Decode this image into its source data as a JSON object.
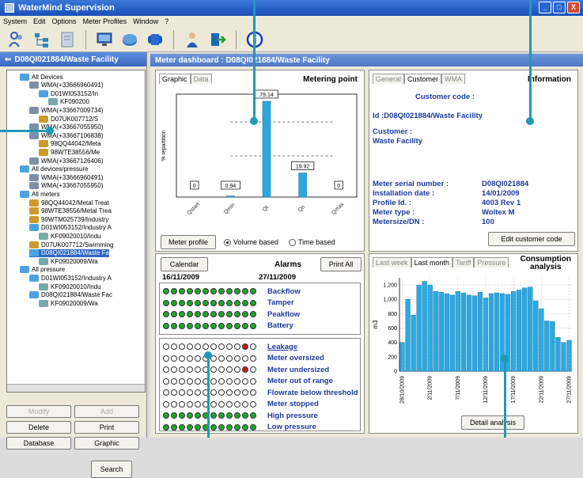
{
  "window": {
    "title": "WaterMind Supervision",
    "controls": [
      "_",
      "□",
      "X"
    ]
  },
  "menu": [
    "System",
    "Edit",
    "Options",
    "Meter Profiles",
    "Window",
    "?"
  ],
  "toolbar_icons": [
    "users-icon",
    "tree-icon",
    "document-icon",
    "monitor-icon",
    "meter-icon",
    "pipe-icon",
    "user-icon",
    "exit-icon",
    "info-icon"
  ],
  "left_panel": {
    "title": "D08QI021884/Waste Facility",
    "tree": [
      {
        "label": "All Devices",
        "indent": 1,
        "icon": "blue"
      },
      {
        "label": "WMA(+33666960491)",
        "indent": 2,
        "icon": "dev"
      },
      {
        "label": "D01WI053152/In",
        "indent": 3,
        "icon": "blue"
      },
      {
        "label": "KF090200",
        "indent": 4,
        "icon": "key"
      },
      {
        "label": "WMA(+33667009734)",
        "indent": 2,
        "icon": "dev"
      },
      {
        "label": "D07UK007712/S",
        "indent": 3,
        "icon": "meter"
      },
      {
        "label": "WMA(+33667055950)",
        "indent": 2,
        "icon": "dev"
      },
      {
        "label": "WMA(+33667106838)",
        "indent": 2,
        "icon": "dev"
      },
      {
        "label": "98QQ44042/Meta",
        "indent": 3,
        "icon": "meter"
      },
      {
        "label": "98WTE38556/Me",
        "indent": 3,
        "icon": "meter"
      },
      {
        "label": "WMA(+33667126406)",
        "indent": 2,
        "icon": "dev"
      },
      {
        "label": "All devices/pressure",
        "indent": 1,
        "icon": "blue"
      },
      {
        "label": "WMA(+33666960491)",
        "indent": 2,
        "icon": "dev"
      },
      {
        "label": "WMA(+33667055950)",
        "indent": 2,
        "icon": "dev"
      },
      {
        "label": "All meters",
        "indent": 1,
        "icon": "blue"
      },
      {
        "label": "98QQ44042/Metal Treat",
        "indent": 2,
        "icon": "meter"
      },
      {
        "label": "98WTE38556/Metal Trea",
        "indent": 2,
        "icon": "meter"
      },
      {
        "label": "99WTM025739/Industry",
        "indent": 2,
        "icon": "meter"
      },
      {
        "label": "D01WI053152/Industry A",
        "indent": 2,
        "icon": "blue"
      },
      {
        "label": "KF09020010/Indu",
        "indent": 3,
        "icon": "key"
      },
      {
        "label": "D07UK007712/Swimming",
        "indent": 2,
        "icon": "meter"
      },
      {
        "label": "D08QI021884/Waste Fa",
        "indent": 2,
        "icon": "blue",
        "selected": true
      },
      {
        "label": "KF09020009/Wa",
        "indent": 3,
        "icon": "key"
      },
      {
        "label": "All pressure",
        "indent": 1,
        "icon": "blue"
      },
      {
        "label": "D01WI053152/Industry A",
        "indent": 2,
        "icon": "blue"
      },
      {
        "label": "KF09020010/Indu",
        "indent": 3,
        "icon": "key"
      },
      {
        "label": "D08QI021884/Waste Fac",
        "indent": 2,
        "icon": "blue"
      },
      {
        "label": "KF09020009/Wa",
        "indent": 3,
        "icon": "key"
      }
    ],
    "buttons": {
      "modify": "Modify",
      "add": "Add",
      "delete": "Delete",
      "print": "Print",
      "database": "Database",
      "graphic": "Graphic",
      "search": "Search"
    }
  },
  "dashboard": {
    "title": "Meter dashboard : D08QI021884/Waste Facility",
    "metering": {
      "tabs": [
        "Graphic",
        "Data"
      ],
      "title": "Metering point",
      "ylabel": "% repartition",
      "meter_profile_button": "Meter profile",
      "radio_volume": "Volume based",
      "radio_time": "Time based"
    },
    "info": {
      "tabs": [
        "General",
        "Customer",
        "WMA"
      ],
      "title": "Information",
      "customer_code_label": "Customer code :",
      "id_line": "Id :D08QI021884/Waste Facility",
      "customer_label": "Customer :",
      "customer_value": "Waste Facility",
      "fields": [
        {
          "label": "Meter serial number :",
          "value": "D08QI021884"
        },
        {
          "label": "Installation date :",
          "value": "14/01/2009"
        },
        {
          "label": "Profile Id. :",
          "value": "4003 Rev 1"
        },
        {
          "label": "Meter type :",
          "value": "Woltex M"
        },
        {
          "label": "Metersize/DN :",
          "value": "100"
        }
      ],
      "edit_button": "Edit customer code"
    },
    "alarms": {
      "calendar_button": "Calendar",
      "title": "Alarms",
      "print_button": "Print All",
      "date_from": "16/11/2009",
      "date_to": "27/11/2009",
      "group1": [
        {
          "label": "Backflow",
          "leds": [
            "g",
            "g",
            "g",
            "g",
            "g",
            "g",
            "g",
            "g",
            "g",
            "g",
            "g",
            "g"
          ]
        },
        {
          "label": "Tamper",
          "leds": [
            "g",
            "g",
            "g",
            "g",
            "g",
            "g",
            "g",
            "g",
            "g",
            "g",
            "g",
            "g"
          ]
        },
        {
          "label": "Peakflow",
          "leds": [
            "g",
            "g",
            "g",
            "g",
            "g",
            "g",
            "g",
            "g",
            "g",
            "g",
            "g",
            "g"
          ]
        },
        {
          "label": "Battery",
          "leds": [
            "g",
            "g",
            "g",
            "g",
            "g",
            "g",
            "g",
            "g",
            "g",
            "g",
            "g",
            "g"
          ]
        }
      ],
      "group2": [
        {
          "label": "Leakage",
          "leds": [
            "o",
            "o",
            "o",
            "o",
            "o",
            "o",
            "o",
            "o",
            "o",
            "o",
            "r",
            "o"
          ]
        },
        {
          "label": "Meter oversized",
          "leds": [
            "o",
            "o",
            "o",
            "o",
            "o",
            "o",
            "o",
            "o",
            "o",
            "o",
            "o",
            "o"
          ]
        },
        {
          "label": "Meter undersized",
          "leds": [
            "o",
            "o",
            "o",
            "o",
            "o",
            "o",
            "o",
            "o",
            "o",
            "o",
            "r",
            "o"
          ]
        },
        {
          "label": "Meter out of range",
          "leds": [
            "o",
            "o",
            "o",
            "o",
            "o",
            "o",
            "o",
            "o",
            "o",
            "o",
            "o",
            "o"
          ]
        },
        {
          "label": "Flowrate below threshold",
          "leds": [
            "o",
            "o",
            "o",
            "o",
            "o",
            "o",
            "o",
            "o",
            "o",
            "o",
            "o",
            "o"
          ]
        },
        {
          "label": "Meter stopped",
          "leds": [
            "o",
            "o",
            "o",
            "o",
            "o",
            "o",
            "o",
            "o",
            "o",
            "o",
            "o",
            "o"
          ]
        },
        {
          "label": "High pressure",
          "leds": [
            "g",
            "g",
            "g",
            "g",
            "g",
            "g",
            "g",
            "g",
            "g",
            "g",
            "g",
            "g"
          ]
        },
        {
          "label": "Low pressure",
          "leds": [
            "g",
            "g",
            "g",
            "g",
            "g",
            "g",
            "g",
            "g",
            "g",
            "g",
            "g",
            "g"
          ]
        }
      ]
    },
    "consumption": {
      "tabs": [
        "Last week",
        "Last month",
        "Tariff",
        "Pressure"
      ],
      "title_line1": "Consumption",
      "title_line2": "analysis",
      "ylabel": "m3",
      "detail_button": "Detail analysis"
    }
  },
  "colors": {
    "bar": "#2aa9e0",
    "led_green": "#1fa82c",
    "led_red": "#cc1a1a",
    "led_off": "#ffffff",
    "callout": "#1e9ab6",
    "label_blue": "#1a3a9a"
  },
  "chart_data": [
    {
      "type": "bar",
      "title": "Metering point",
      "ylabel": "% repartition",
      "categories": [
        "Qstart",
        "Qmin",
        "Qt",
        "Qn",
        "Qmax"
      ],
      "values": [
        0,
        0.94,
        79.14,
        19.92,
        0
      ],
      "value_labels": [
        "0",
        "0.94",
        "79.14",
        "19.92",
        "0"
      ],
      "ylim": [
        0,
        85
      ]
    },
    {
      "type": "bar",
      "title": "Consumption analysis",
      "ylabel": "m3",
      "yticks": [
        "0",
        "200",
        "400",
        "600",
        "800",
        "1,000",
        "1,200"
      ],
      "xtick_labels": [
        "28/10/2009",
        "2/11/2009",
        "7/11/2009",
        "12/11/2009",
        "17/11/2009",
        "22/11/2009",
        "27/11/2009"
      ],
      "x": [
        "28/10",
        "29/10",
        "30/10",
        "31/10",
        "1/11",
        "2/11",
        "3/11",
        "4/11",
        "5/11",
        "6/11",
        "7/11",
        "8/11",
        "9/11",
        "10/11",
        "11/11",
        "12/11",
        "13/11",
        "14/11",
        "15/11",
        "16/11",
        "17/11",
        "18/11",
        "19/11",
        "20/11",
        "21/11",
        "22/11",
        "23/11",
        "24/11",
        "25/11",
        "26/11",
        "27/11"
      ],
      "values": [
        400,
        1000,
        780,
        1200,
        1250,
        1200,
        1110,
        1100,
        1080,
        1060,
        1110,
        1090,
        1060,
        1050,
        1100,
        1020,
        1080,
        1090,
        1080,
        1070,
        1110,
        1130,
        1160,
        1170,
        980,
        870,
        700,
        690,
        470,
        400,
        430
      ],
      "ylim": [
        0,
        1300
      ]
    }
  ]
}
